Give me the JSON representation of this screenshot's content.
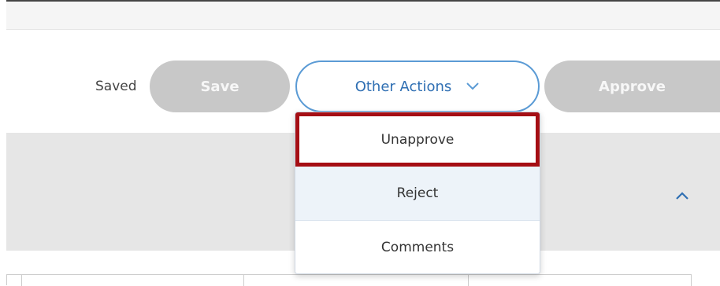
{
  "actions": {
    "status": "Saved",
    "save_label": "Save",
    "other_actions_label": "Other Actions",
    "approve_label": "Approve"
  },
  "dropdown": {
    "items": [
      {
        "label": "Unapprove",
        "highlighted": true
      },
      {
        "label": "Reject"
      },
      {
        "label": "Comments"
      }
    ]
  },
  "colors": {
    "accent": "#2f6fb3",
    "outline": "#5b9bd5",
    "highlight": "#a50e14",
    "disabled": "#c8c8c8"
  },
  "icons": {
    "dropdown": "chevron-down-icon",
    "section": "chevron-up-icon"
  }
}
